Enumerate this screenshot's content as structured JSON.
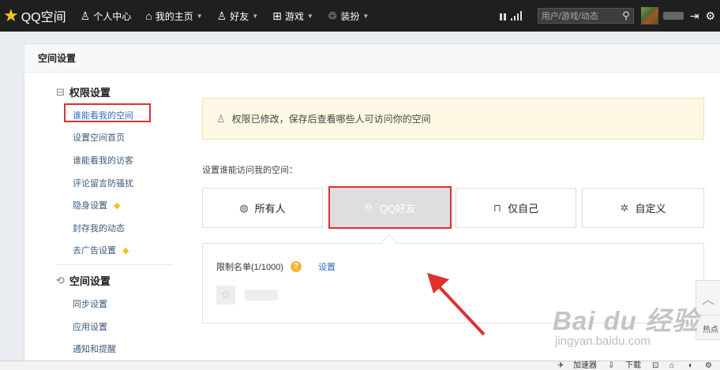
{
  "topbar": {
    "logo_text": "QQ空间",
    "nav": [
      {
        "label": "个人中心",
        "icon": "person-icon",
        "glyph": "♙",
        "caret": false
      },
      {
        "label": "我的主页",
        "icon": "home-icon",
        "glyph": "⌂",
        "caret": true
      },
      {
        "label": "好友",
        "icon": "friends-icon",
        "glyph": "♙",
        "caret": true
      },
      {
        "label": "游戏",
        "icon": "grid-icon",
        "glyph": "⊞",
        "caret": true
      },
      {
        "label": "装扮",
        "icon": "shirt-icon",
        "glyph": "♲",
        "caret": true
      }
    ],
    "search_placeholder": "用户/游戏/动态"
  },
  "panel": {
    "title": "空间设置"
  },
  "sidebar": {
    "group1": {
      "title": "权限设置",
      "icon": "lock-icon"
    },
    "group1_items": [
      {
        "label": "谁能看我的空间",
        "active": true,
        "gem": false
      },
      {
        "label": "设置空间首页",
        "active": false,
        "gem": false
      },
      {
        "label": "谁能看我的访客",
        "active": false,
        "gem": false
      },
      {
        "label": "评论留言防骚扰",
        "active": false,
        "gem": false
      },
      {
        "label": "隐身设置",
        "active": false,
        "gem": true
      },
      {
        "label": "封存我的动态",
        "active": false,
        "gem": false
      },
      {
        "label": "去广告设置",
        "active": false,
        "gem": true
      }
    ],
    "group2": {
      "title": "空间设置",
      "icon": "gear-tag-icon"
    },
    "group2_items": [
      {
        "label": "同步设置"
      },
      {
        "label": "应用设置"
      },
      {
        "label": "通知和提醒"
      }
    ]
  },
  "content": {
    "notice": "权限已修改，保存后查看哪些人可访问你的空间",
    "setting_label": "设置谁能访问我的空间：",
    "options": [
      {
        "label": "所有人",
        "icon": "globe-icon",
        "selected": false
      },
      {
        "label": "QQ好友",
        "icon": "qq-penguin-icon",
        "selected": true
      },
      {
        "label": "仅自己",
        "icon": "lock-icon",
        "selected": false
      },
      {
        "label": "自定义",
        "icon": "gear-icon",
        "selected": false
      }
    ],
    "limit_label": "限制名单(1/1000)",
    "help": "?",
    "set_link": "设置"
  },
  "float": {
    "hot_label": "热点"
  },
  "watermark": {
    "main": "Bai du 经验",
    "url": "jingyan.baidu.com"
  },
  "statusbar": {
    "accelerator": "加速器",
    "download": "下载"
  },
  "colors": {
    "highlight_red": "#e0302e",
    "topbar_bg": "#1f1f1f",
    "link_blue": "#2b6cc4",
    "notice_bg": "#fcf8e4"
  }
}
